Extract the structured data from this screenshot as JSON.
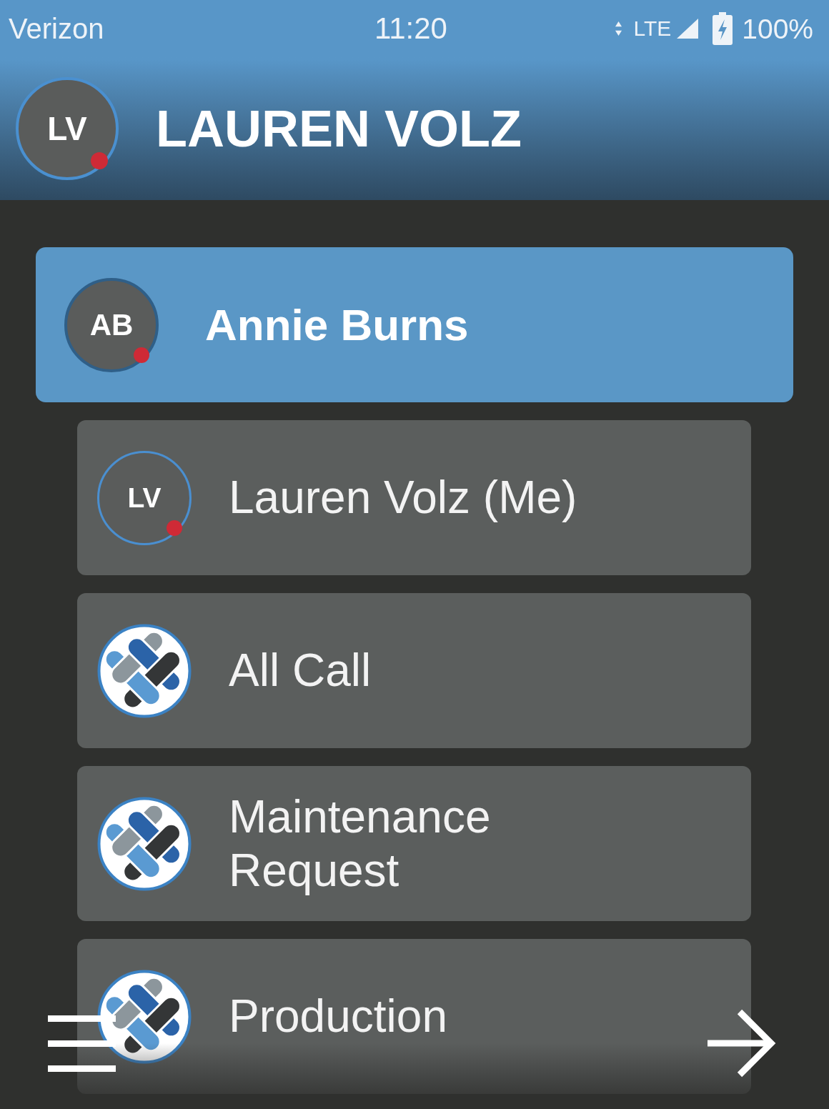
{
  "status_bar": {
    "carrier": "Verizon",
    "time": "11:20",
    "network": "LTE",
    "battery": "100%"
  },
  "header": {
    "initials": "LV",
    "title": "LAUREN VOLZ"
  },
  "list": [
    {
      "kind": "contact",
      "initials": "AB",
      "name": "Annie Burns",
      "selected": true,
      "children": [
        {
          "kind": "contact",
          "initials": "LV",
          "name": "Lauren Volz (Me)",
          "selected": false
        },
        {
          "kind": "channel",
          "name": "All Call",
          "selected": false
        },
        {
          "kind": "channel",
          "name": "Maintenance Request",
          "selected": false
        },
        {
          "kind": "channel",
          "name": "Production",
          "selected": false
        }
      ]
    }
  ]
}
